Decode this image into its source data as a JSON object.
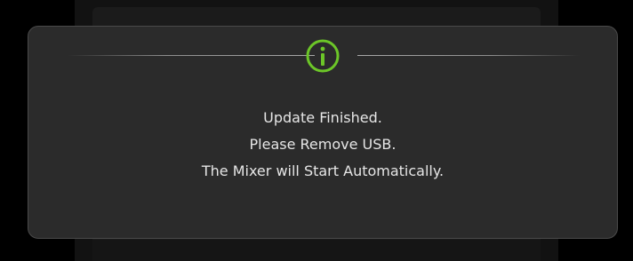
{
  "dialog": {
    "icon": "info-icon",
    "accent_color": "#6cc628",
    "lines": [
      "Update Finished.",
      "Please Remove USB.",
      "The Mixer will Start Automatically."
    ]
  }
}
